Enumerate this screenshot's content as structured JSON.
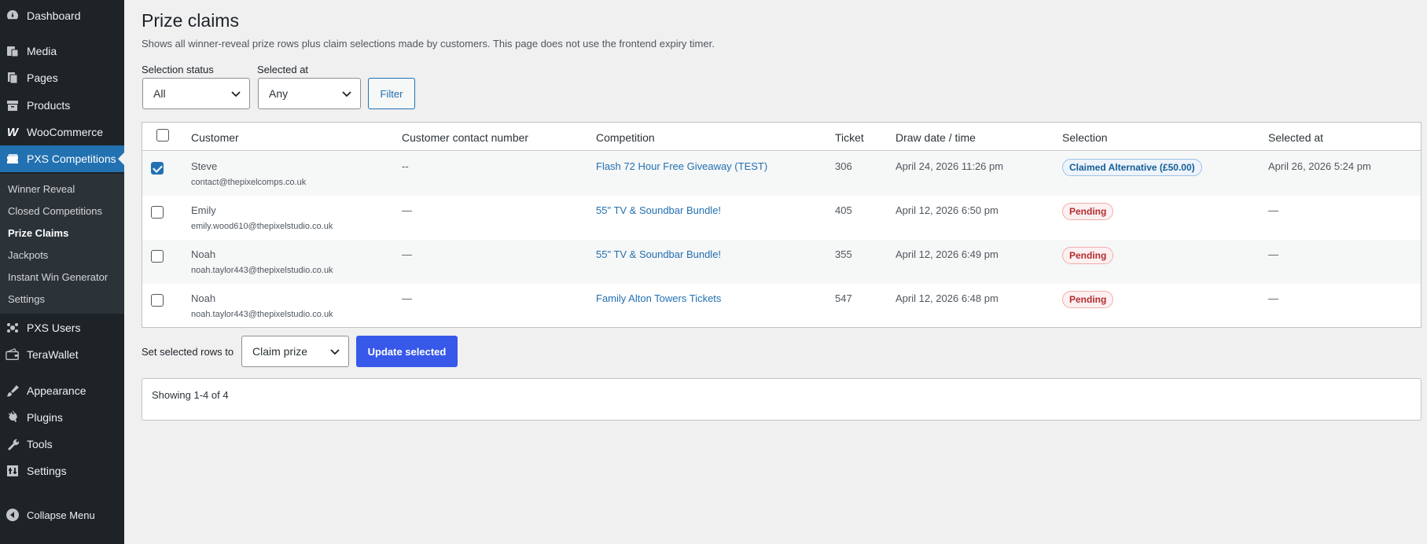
{
  "sidebar": {
    "items": [
      {
        "label": "Dashboard",
        "icon": "dashboard-icon"
      },
      {
        "label": "Media",
        "icon": "media-icon"
      },
      {
        "label": "Pages",
        "icon": "pages-icon"
      },
      {
        "label": "Products",
        "icon": "products-icon"
      },
      {
        "label": "WooCommerce",
        "icon": "woocommerce-icon"
      },
      {
        "label": "PXS Competitions",
        "icon": "competitions-icon"
      },
      {
        "label": "PXS Users",
        "icon": "users-icon"
      },
      {
        "label": "TeraWallet",
        "icon": "wallet-icon"
      },
      {
        "label": "Appearance",
        "icon": "appearance-icon"
      },
      {
        "label": "Plugins",
        "icon": "plugins-icon"
      },
      {
        "label": "Tools",
        "icon": "tools-icon"
      },
      {
        "label": "Settings",
        "icon": "settings-icon"
      },
      {
        "label": "Collapse Menu",
        "icon": "collapse-icon"
      }
    ],
    "submenu": [
      "Winner Reveal",
      "Closed Competitions",
      "Prize Claims",
      "Jackpots",
      "Instant Win Generator",
      "Settings"
    ],
    "current_submenu": "Prize Claims"
  },
  "page": {
    "title": "Prize claims",
    "description": "Shows all winner-reveal prize rows plus claim selections made by customers. This page does not use the frontend expiry timer."
  },
  "filters": {
    "status_label": "Selection status",
    "status_value": "All",
    "selected_at_label": "Selected at",
    "selected_at_value": "Any",
    "filter_button": "Filter"
  },
  "table": {
    "headers": [
      "Customer",
      "Customer contact number",
      "Competition",
      "Ticket",
      "Draw date / time",
      "Selection",
      "Selected at"
    ],
    "rows": [
      {
        "checked": true,
        "name": "Steve",
        "email": "contact@thepixelcomps.co.uk",
        "contact": "--",
        "competition": "Flash 72 Hour Free Giveaway (TEST)",
        "ticket": "306",
        "draw": "April 24, 2026 11:26 pm",
        "selection": "Claimed Alternative (£50.00)",
        "selection_type": "claimed",
        "selected_at": "April 26, 2026 5:24 pm"
      },
      {
        "checked": false,
        "name": "Emily",
        "email": "emily.wood610@thepixelstudio.co.uk",
        "contact": "—",
        "competition": "55\" TV & Soundbar Bundle!",
        "ticket": "405",
        "draw": "April 12, 2026 6:50 pm",
        "selection": "Pending",
        "selection_type": "pending",
        "selected_at": "—"
      },
      {
        "checked": false,
        "name": "Noah",
        "email": "noah.taylor443@thepixelstudio.co.uk",
        "contact": "—",
        "competition": "55\" TV & Soundbar Bundle!",
        "ticket": "355",
        "draw": "April 12, 2026 6:49 pm",
        "selection": "Pending",
        "selection_type": "pending",
        "selected_at": "—"
      },
      {
        "checked": false,
        "name": "Noah",
        "email": "noah.taylor443@thepixelstudio.co.uk",
        "contact": "—",
        "competition": "Family Alton Towers Tickets",
        "ticket": "547",
        "draw": "April 12, 2026 6:48 pm",
        "selection": "Pending",
        "selection_type": "pending",
        "selected_at": "—"
      }
    ]
  },
  "bulk": {
    "label": "Set selected rows to",
    "value": "Claim prize",
    "button": "Update selected"
  },
  "summary": "Showing 1-4 of 4",
  "colors": {
    "accent": "#2271b1",
    "primary_button": "#3858e9",
    "pending": "#b32d2e",
    "claimed": "#135e96"
  }
}
